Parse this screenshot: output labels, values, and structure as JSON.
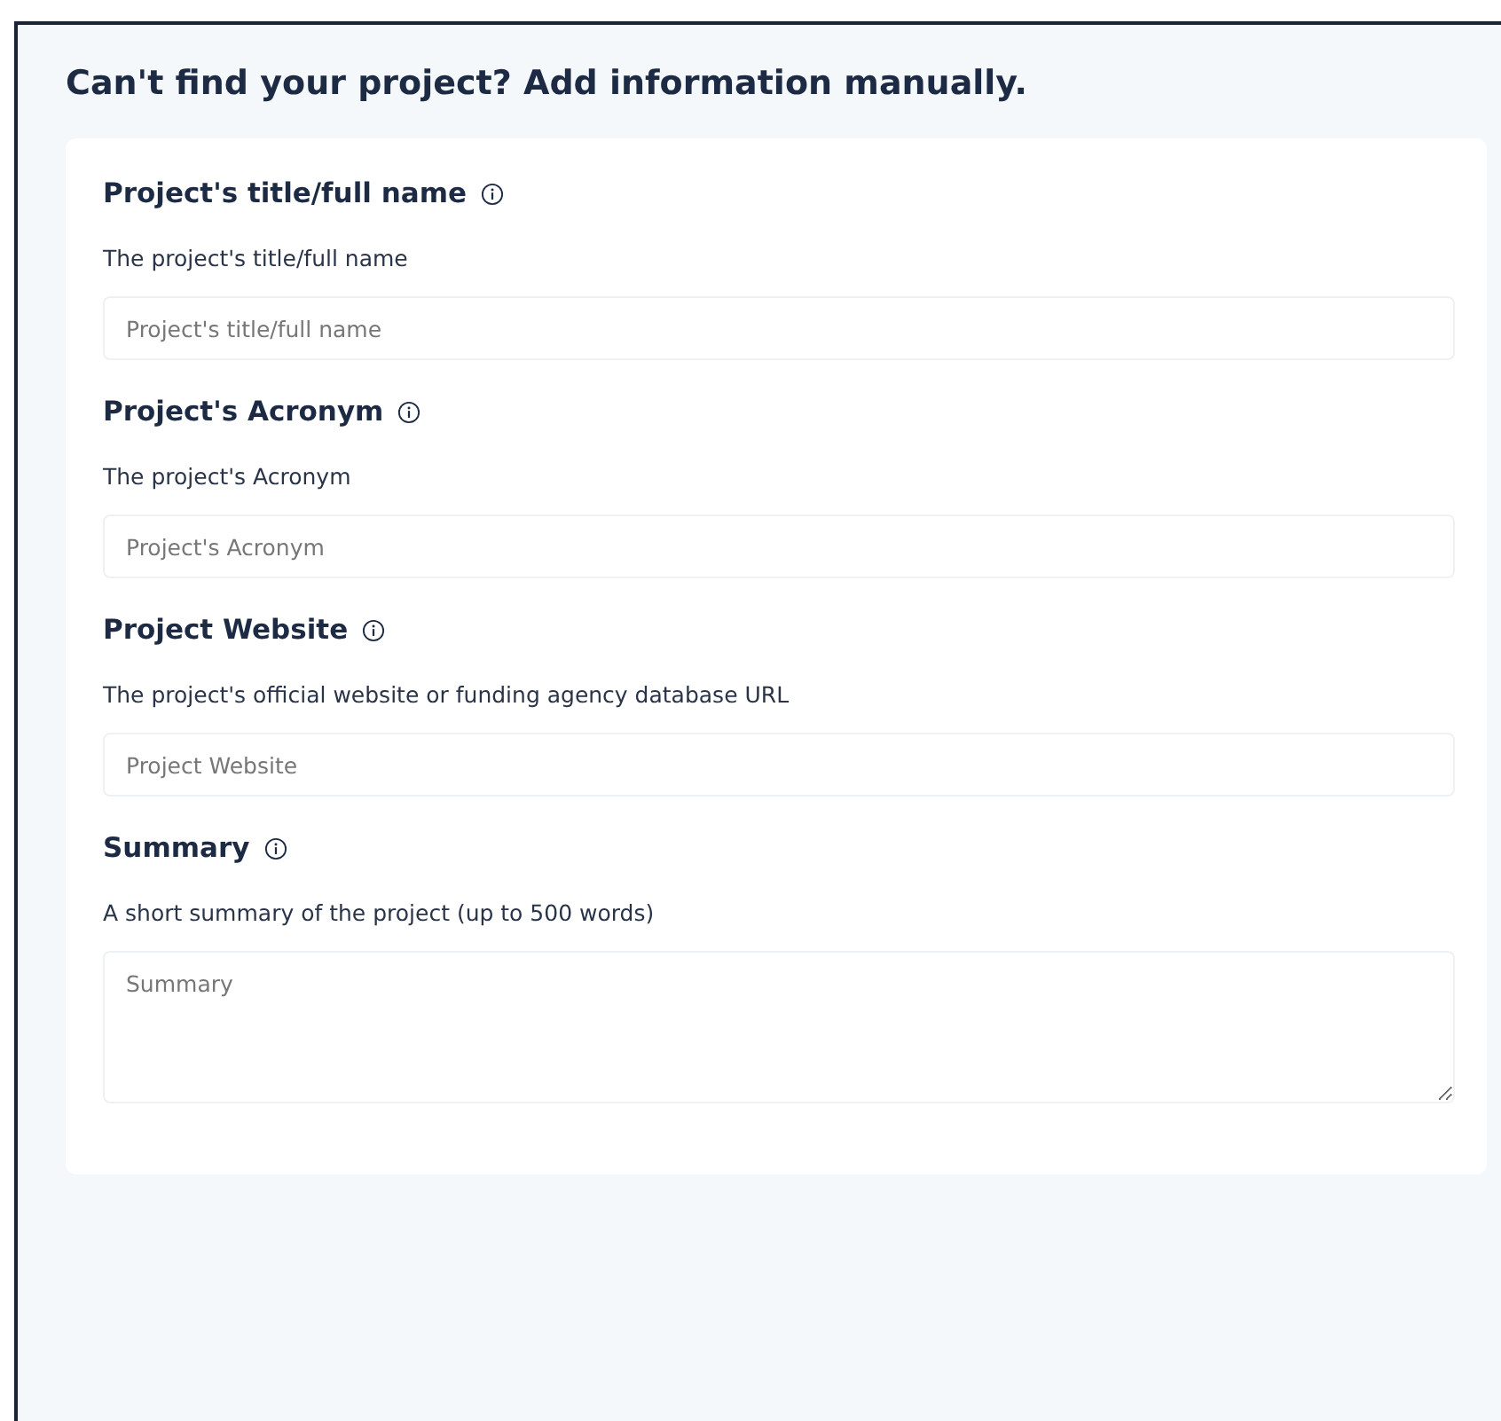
{
  "heading": "Can't find your project? Add information manually.",
  "fields": [
    {
      "label": "Project's title/full name",
      "description": "The project's title/full name",
      "placeholder": "Project's title/full name",
      "kind": "input"
    },
    {
      "label": "Project's Acronym",
      "description": "The project's Acronym",
      "placeholder": "Project's Acronym",
      "kind": "input"
    },
    {
      "label": "Project Website",
      "description": "The project's official website or funding agency database URL",
      "placeholder": "Project Website",
      "kind": "input"
    },
    {
      "label": "Summary",
      "description": "A short summary of the project (up to 500 words)",
      "placeholder": "Summary",
      "kind": "textarea"
    }
  ]
}
